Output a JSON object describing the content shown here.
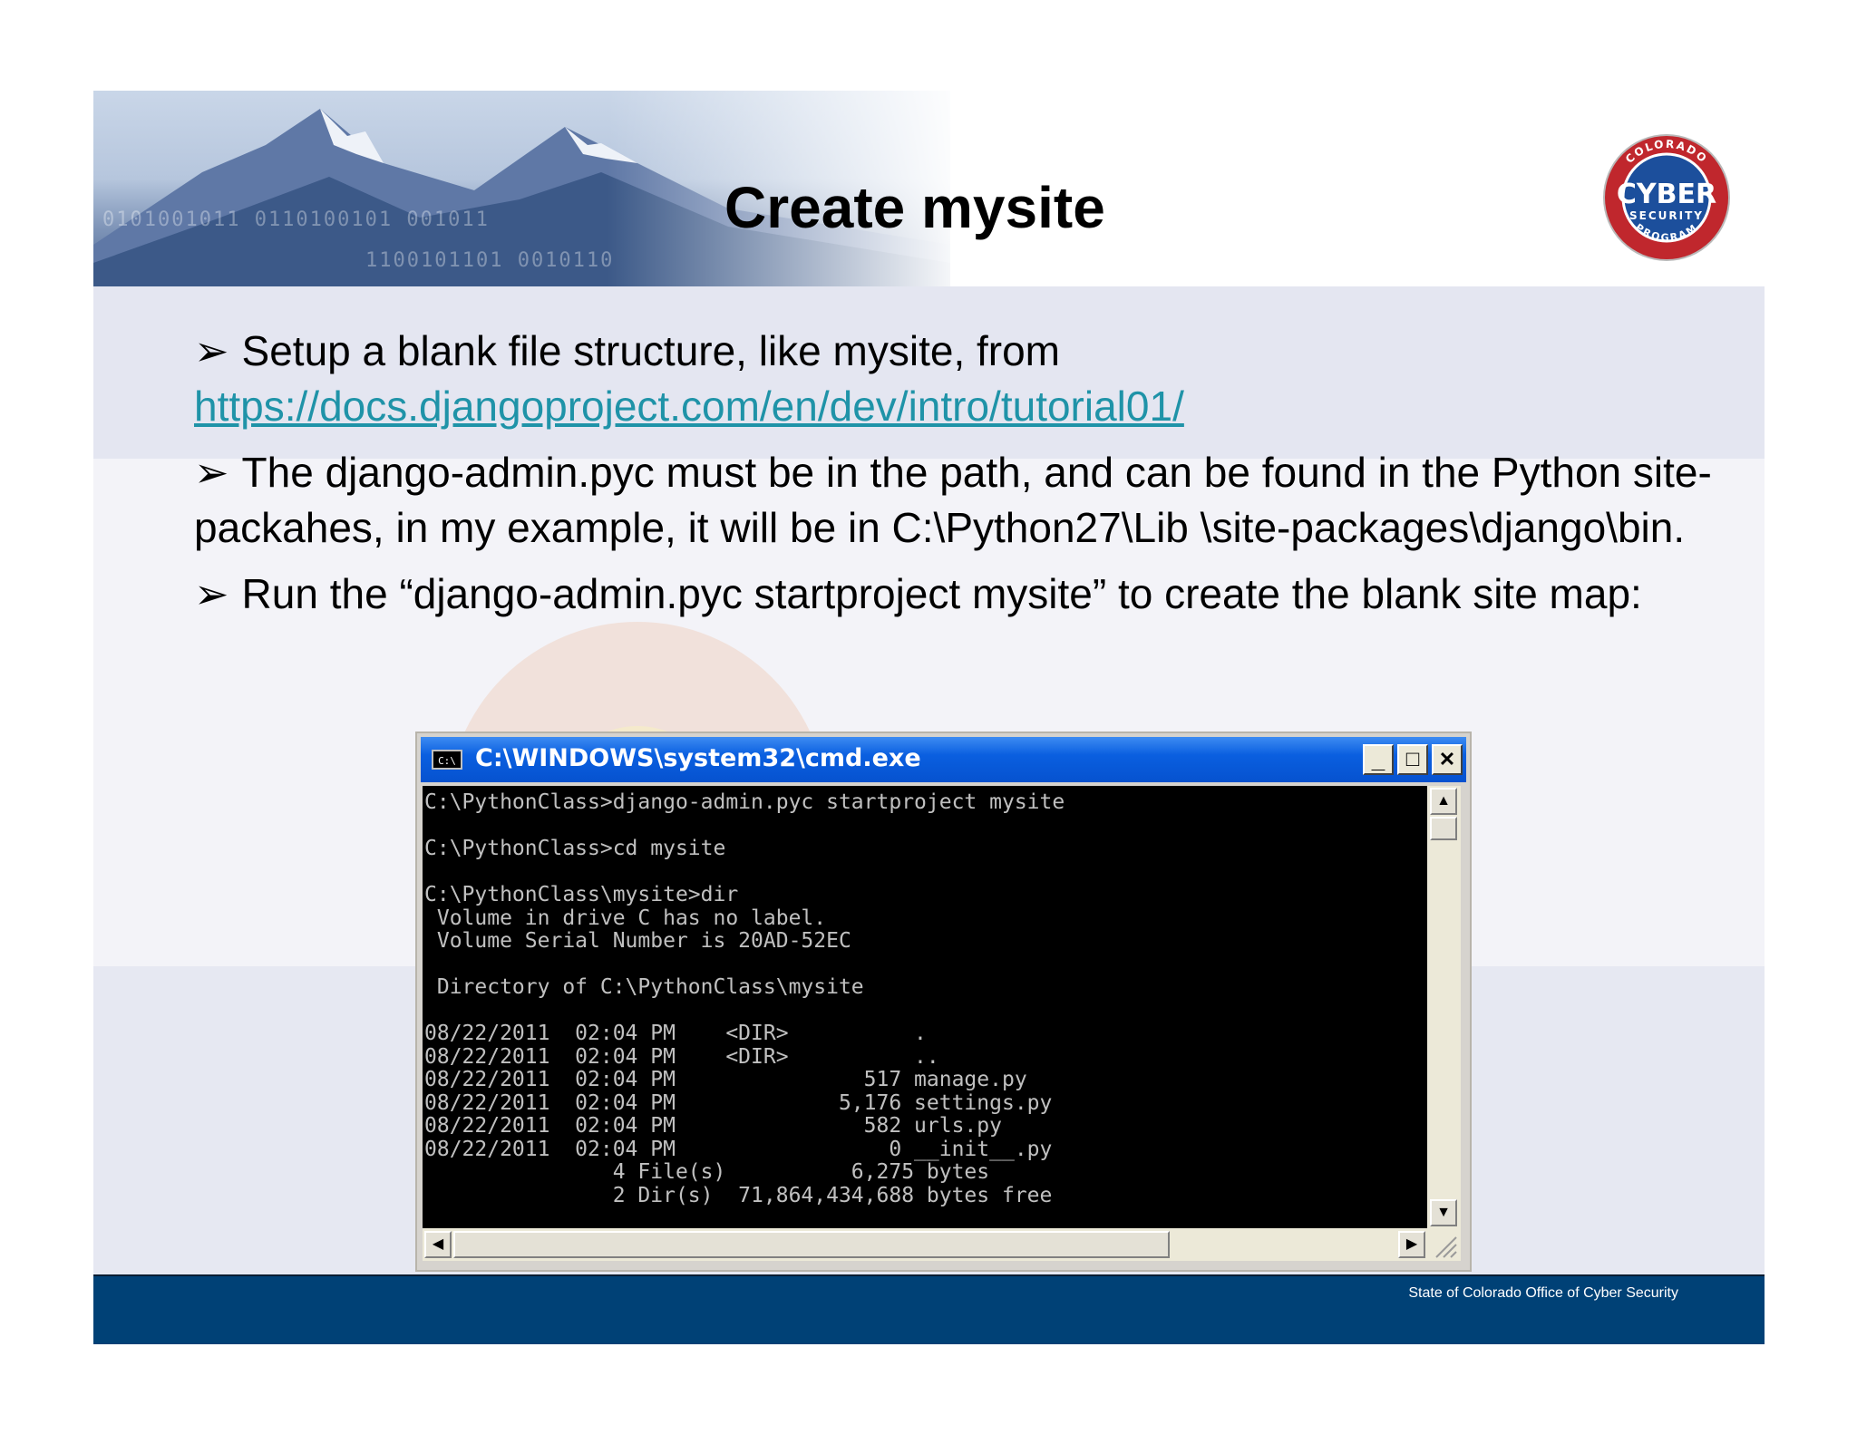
{
  "slide": {
    "title": "Create mysite",
    "logo": {
      "top_text": "COLORADO",
      "main_text": "CYBER",
      "sub_text": "SECURITY",
      "bottom_text": "PROGRAM",
      "ring_color": "#c0272d"
    },
    "bullets": [
      {
        "text": "Setup a blank file structure, like mysite, from",
        "link": "https://docs.djangoproject.com/en/dev/intro/tutorial01/"
      },
      {
        "text": "The django-admin.pyc must be in the path, and can be found in the Python site-packahes, in my example, it will be in C:\\Python27\\Lib \\site-packages\\django\\bin."
      },
      {
        "text": "Run the “django-admin.pyc startproject mysite” to create the blank site map:"
      }
    ],
    "bullet_glyph": "➢",
    "footer_text": "State of Colorado Office of Cyber Security",
    "colors": {
      "footer_bg": "#004176",
      "link": "#1f93a8",
      "cmd_titlebar": "#0a5fe0"
    }
  },
  "cmd_window": {
    "title": "C:\\WINDOWS\\system32\\cmd.exe",
    "icon_label": "C:\\",
    "buttons": {
      "minimize": "_",
      "maximize": "□",
      "close": "✕"
    },
    "lines": [
      "C:\\PythonClass>django-admin.pyc startproject mysite",
      "",
      "C:\\PythonClass>cd mysite",
      "",
      "C:\\PythonClass\\mysite>dir",
      " Volume in drive C has no label.",
      " Volume Serial Number is 20AD-52EC",
      "",
      " Directory of C:\\PythonClass\\mysite",
      "",
      "08/22/2011  02:04 PM    <DIR>          .",
      "08/22/2011  02:04 PM    <DIR>          ..",
      "08/22/2011  02:04 PM               517 manage.py",
      "08/22/2011  02:04 PM             5,176 settings.py",
      "08/22/2011  02:04 PM               582 urls.py",
      "08/22/2011  02:04 PM                 0 __init__.py",
      "               4 File(s)          6,275 bytes",
      "               2 Dir(s)  71,864,434,688 bytes free"
    ]
  }
}
